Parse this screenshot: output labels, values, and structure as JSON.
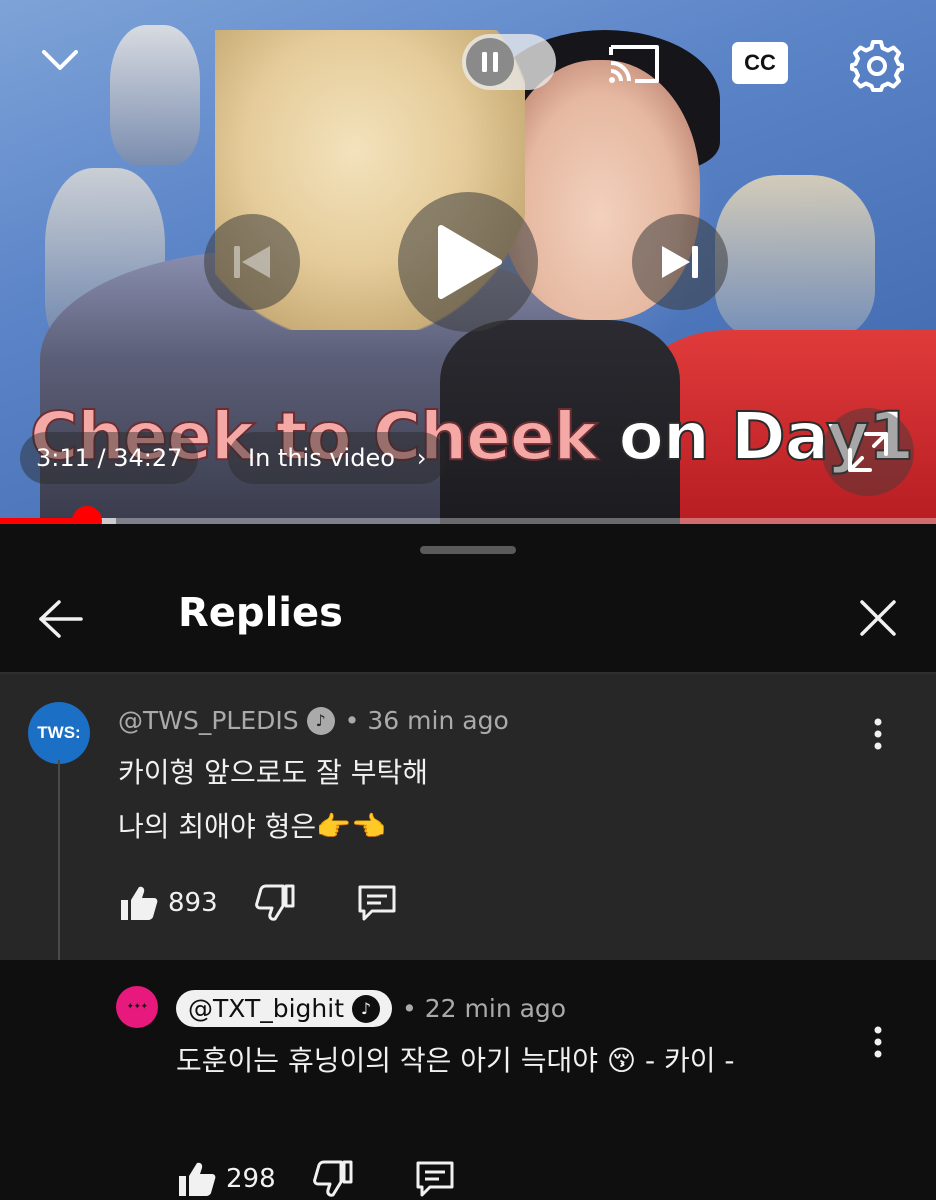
{
  "player": {
    "title_part1": "Cheek to Cheek",
    "title_part2": "on Day1",
    "time_display": "3:11 / 34:27",
    "chapter_label": "In this video",
    "chapter_chevron": "›",
    "cc_label": "CC",
    "progress": {
      "current": "3:11",
      "duration": "34:27",
      "played_fraction": 0.093,
      "buffered_fraction": 0.124
    },
    "colors": {
      "progress": "#ff0000"
    },
    "icons": {
      "collapse": "chevron-down-icon",
      "autoplay": "pause-icon",
      "cast": "cast-icon",
      "settings": "gear-icon",
      "previous": "skip-previous-icon",
      "play": "play-icon",
      "next": "skip-next-icon",
      "fullscreen": "fullscreen-icon"
    }
  },
  "sheet": {
    "title": "Replies",
    "icons": {
      "back": "arrow-left-icon",
      "close": "close-icon"
    }
  },
  "comments": [
    {
      "author": "@TWS_PLEDIS",
      "avatar_text": "TWS:",
      "verified_glyph": "♪",
      "separator": "•",
      "time": "36 min ago",
      "lines": [
        "카이형 앞으로도 잘 부탁해",
        "나의 최애야 형은👉👈"
      ],
      "likes": "893"
    },
    {
      "author": "@TXT_bighit",
      "avatar_text": "✦✦✦",
      "verified_glyph": "♪",
      "separator": "•",
      "time": "22 min ago",
      "lines": [
        "도훈이는 휴닝이의 작은 아기 늑대야 😚 - 카이 -"
      ],
      "likes": "298"
    }
  ]
}
